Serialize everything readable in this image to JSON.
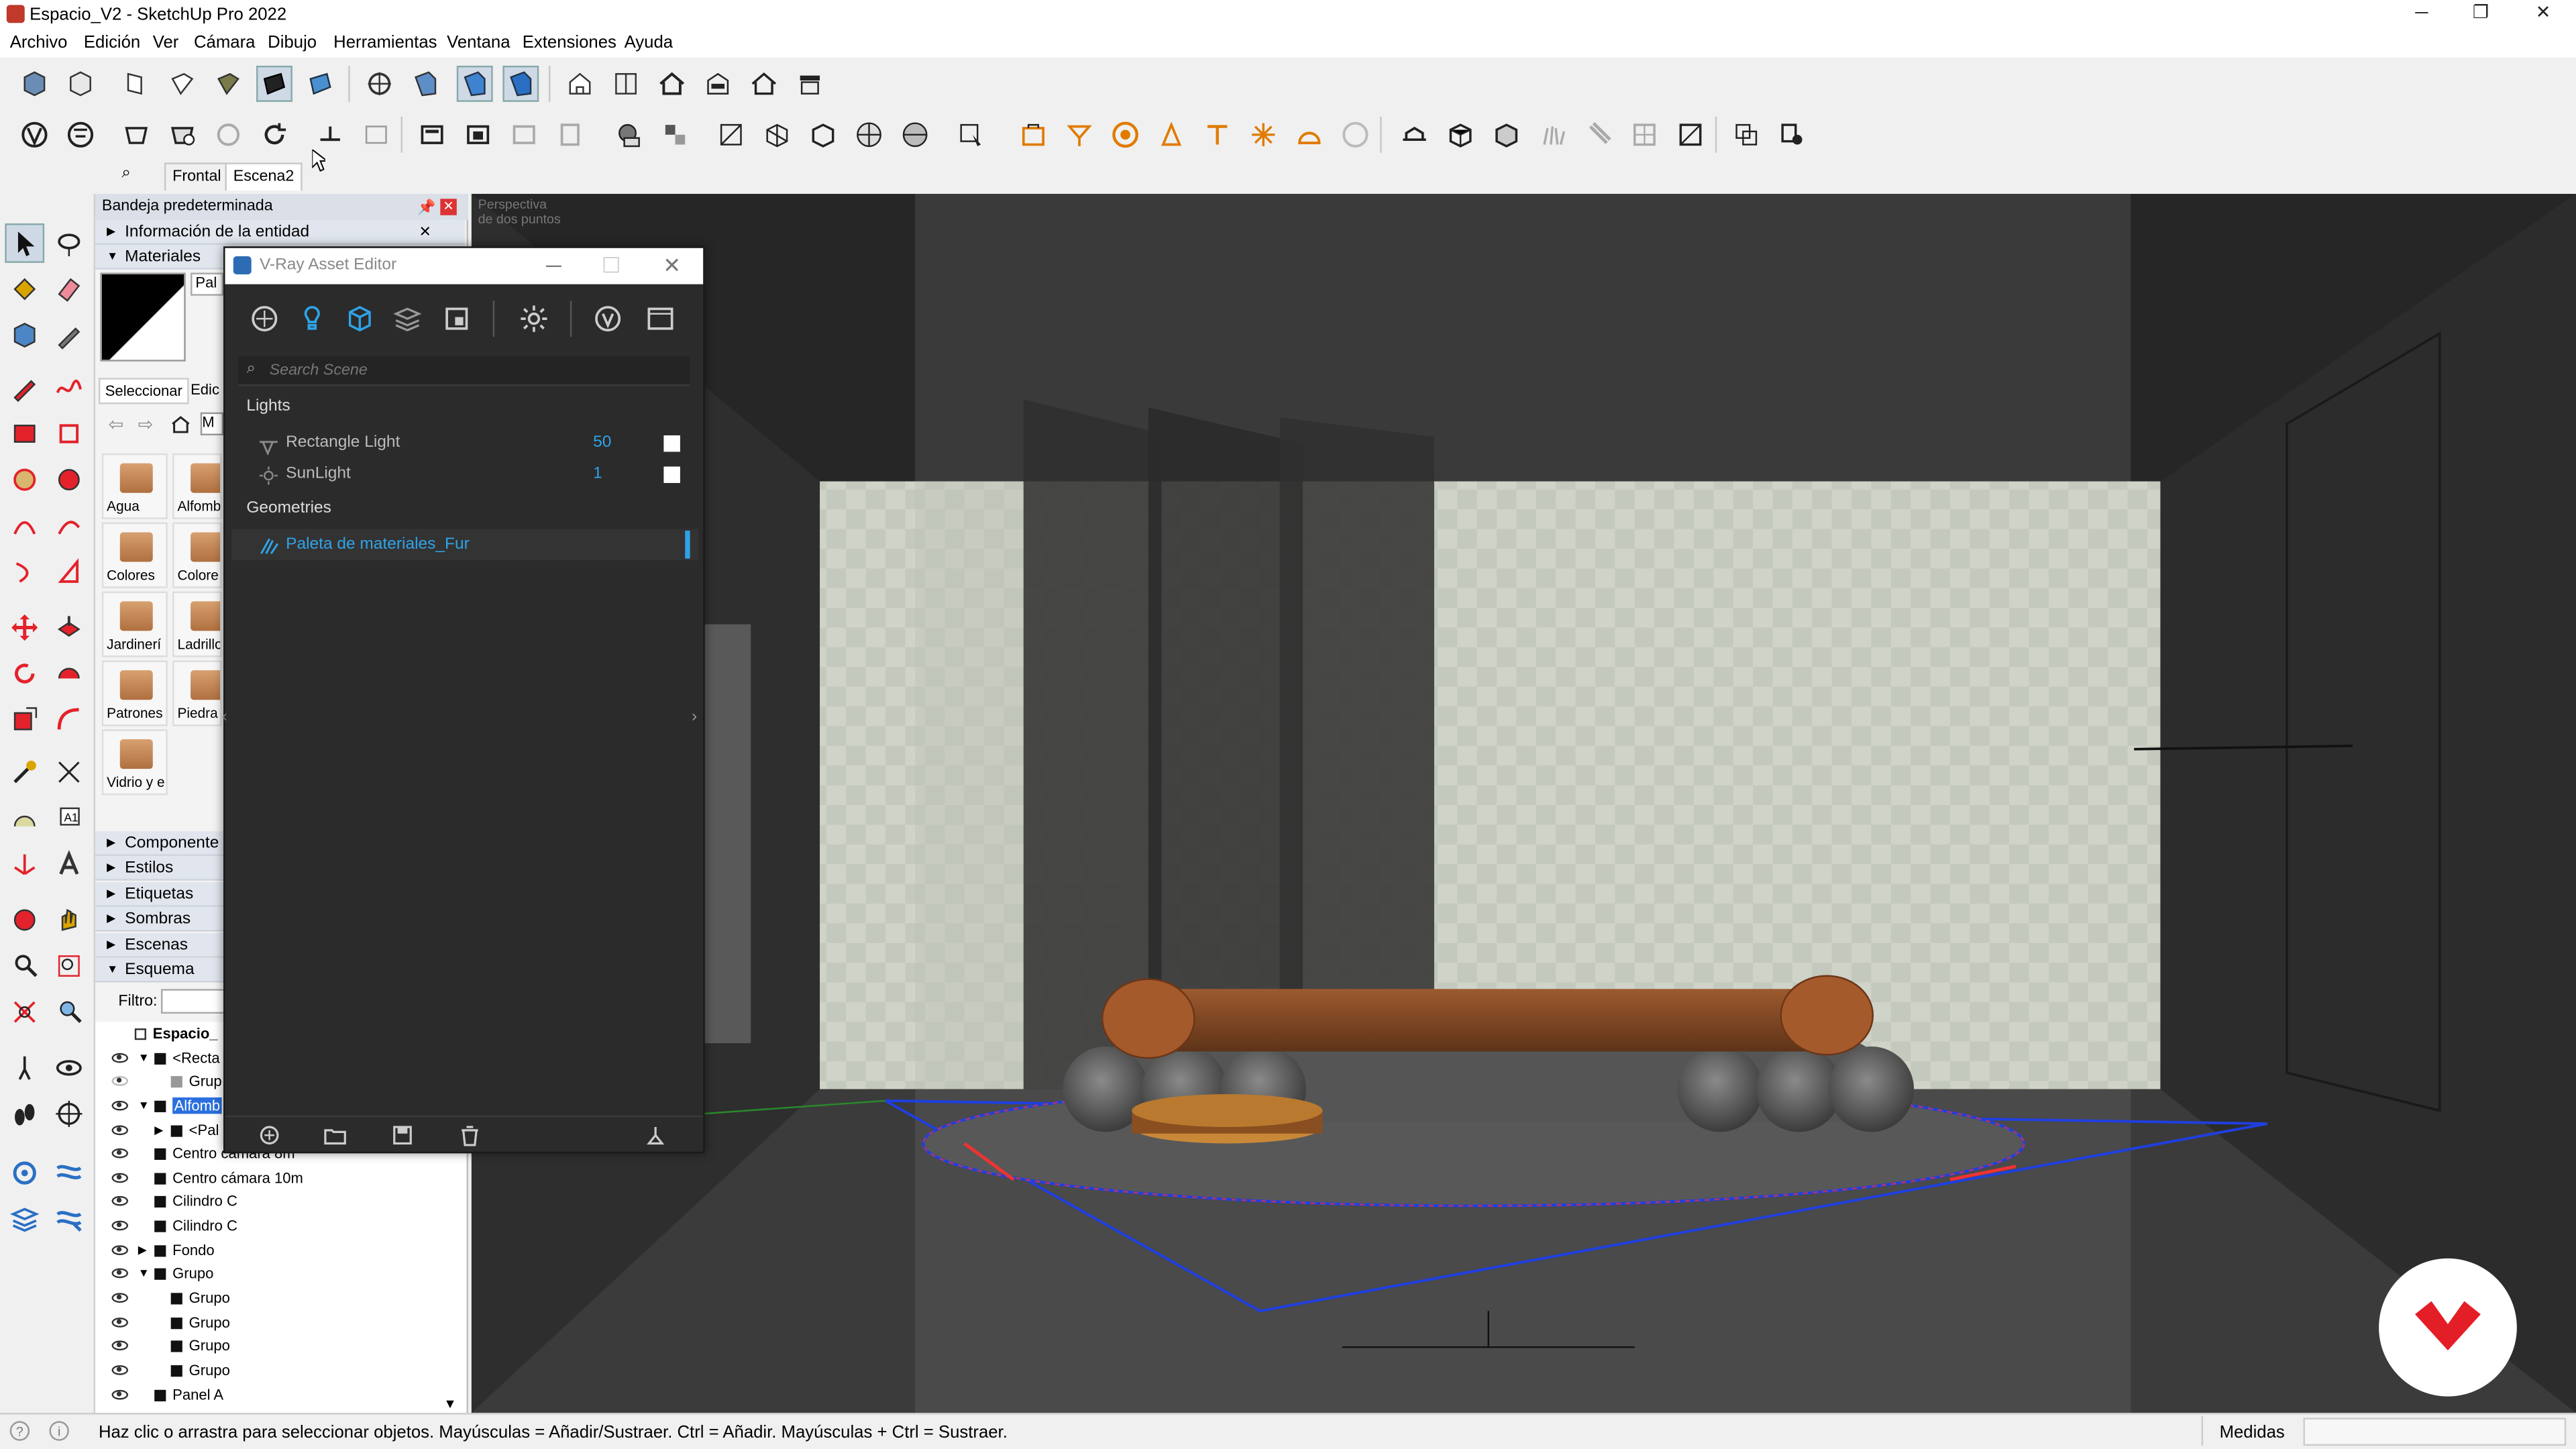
{
  "window": {
    "title": "Espacio_V2 - SketchUp Pro 2022",
    "minimize": "─",
    "restore": "❐",
    "close": "✕"
  },
  "menu": [
    "Archivo",
    "Edición",
    "Ver",
    "Cámara",
    "Dibujo",
    "Herramientas",
    "Ventana",
    "Extensiones",
    "Ayuda"
  ],
  "scene_tabs": {
    "search_icon": "search-icon",
    "tabs": [
      "Frontal",
      "Escena2"
    ],
    "active": "Escena2"
  },
  "tray": {
    "title": "Bandeja predeterminada",
    "entity_info": "Información de la entidad",
    "materials": "Materiales",
    "material_name": "Pal",
    "select_tab": "Seleccionar",
    "edit_tab": "Edic",
    "library_field": "M",
    "thumbs": [
      "Agua",
      "Alfomb",
      "Colores",
      "Colore",
      "Jardinerí",
      "Ladrillo",
      "Patrones",
      "Piedra",
      "Vidrio y e"
    ],
    "panels": [
      "Componente",
      "Estilos",
      "Etiquetas",
      "Sombras",
      "Escenas",
      "Esquema"
    ],
    "filter_label": "Filtro:",
    "outliner": [
      {
        "label": "Espacio_",
        "bold": true
      },
      {
        "label": "<Recta"
      },
      {
        "label": "Grup"
      },
      {
        "label": "Alfomb",
        "selected": true
      },
      {
        "label": "<Pal"
      },
      {
        "label": "Centro cámara 8m"
      },
      {
        "label": "Centro cámara 10m"
      },
      {
        "label": "Cilindro C"
      },
      {
        "label": "Cilindro C"
      },
      {
        "label": "Fondo"
      },
      {
        "label": "Grupo"
      },
      {
        "label": "Grupo"
      },
      {
        "label": "Grupo"
      },
      {
        "label": "Grupo"
      },
      {
        "label": "Grupo"
      },
      {
        "label": "Panel A"
      }
    ]
  },
  "viewport": {
    "label_line1": "Perspectiva",
    "label_line2": "de dos puntos"
  },
  "vray": {
    "title": "V-Ray Asset Editor",
    "search_placeholder": "Search Scene",
    "lights_header": "Lights",
    "lights": [
      {
        "name": "Rectangle Light",
        "value": "50"
      },
      {
        "name": "SunLight",
        "value": "1"
      }
    ],
    "geometries_header": "Geometries",
    "geometries": [
      {
        "name": "Paleta de materiales_Fur"
      }
    ],
    "accent": "#2fa3e8"
  },
  "status": {
    "text": "Haz clic o arrastra para seleccionar objetos. Mayúsculas = Añadir/Sustraer. Ctrl = Añadir. Mayúsculas + Ctrl = Sustraer.",
    "measures_label": "Medidas"
  },
  "colors": {
    "selection_blue": "#1f3fe0",
    "logo_red": "#e41e26"
  }
}
